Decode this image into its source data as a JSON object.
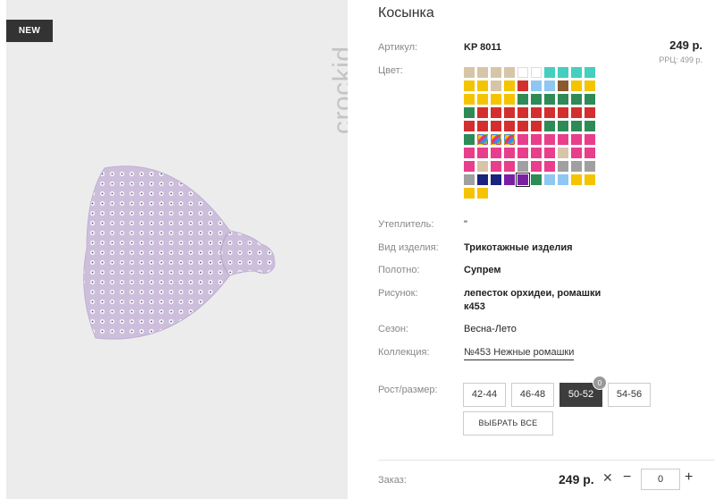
{
  "badge": "NEW",
  "brand": "crockid",
  "product": {
    "title": "Косынка",
    "price": "249 р.",
    "rrp": "РРЦ: 499 р."
  },
  "labels": {
    "article": "Артикул:",
    "color": "Цвет:",
    "insulation": "Утеплитель:",
    "type": "Вид изделия:",
    "fabric": "Полотно:",
    "pattern": "Рисунок:",
    "season": "Сезон:",
    "collection": "Коллекция:",
    "size": "Рост/размер:",
    "order": "Заказ:"
  },
  "values": {
    "article": "KP 8011",
    "insulation": "\"",
    "type": "Трикотажные изделия",
    "fabric": "Супрем",
    "pattern_line1": "лепесток орхидеи, ромашки",
    "pattern_line2": "к453",
    "season": "Весна-Лето",
    "collection": "№453 Нежные ромашки"
  },
  "swatch_colors": [
    "#d7c5a8",
    "#d7c5a8",
    "#d7c5a8",
    "#d7c5a8",
    "#ffffff",
    "#ffffff",
    "#45cfc0",
    "#45cfc0",
    "#45cfc0",
    "#45cfc0",
    "#f5c400",
    "#f5c400",
    "#d7c5a8",
    "#f5c400",
    "#d32f2f",
    "#8fc7f0",
    "#8fc7f0",
    "#8a5a2b",
    "#f5c400",
    "#f5c400",
    "#f5c400",
    "#f5c400",
    "#f5c400",
    "#f5c400",
    "#2e8b57",
    "#2e8b57",
    "#2e8b57",
    "#2e8b57",
    "#2e8b57",
    "#2e8b57",
    "#2e8b57",
    "#d32f2f",
    "#d32f2f",
    "#d32f2f",
    "#d32f2f",
    "#d32f2f",
    "#d32f2f",
    "#d32f2f",
    "#d32f2f",
    "#d32f2f",
    "#d32f2f",
    "#d32f2f",
    "#d32f2f",
    "#d32f2f",
    "#d32f2f",
    "#d32f2f",
    "#2e8b57",
    "#2e8b57",
    "#2e8b57",
    "#2e8b57",
    "#2e8b57",
    "#rainbow",
    "#rainbow",
    "#rainbow",
    "#e83e8c",
    "#e83e8c",
    "#e83e8c",
    "#e83e8c",
    "#e83e8c",
    "#e83e8c",
    "#e83e8c",
    "#e83e8c",
    "#e83e8c",
    "#e83e8c",
    "#e83e8c",
    "#e83e8c",
    "#e83e8c",
    "#d7c5a8",
    "#e83e8c",
    "#e83e8c",
    "#e83e8c",
    "#d7c5a8",
    "#e83e8c",
    "#e83e8c",
    "#a0a0a0",
    "#e83e8c",
    "#e83e8c",
    "#a0a0a0",
    "#a0a0a0",
    "#a0a0a0",
    "#a0a0a0",
    "#1a237e",
    "#1a237e",
    "#7b1fa2",
    "#7b1fa2",
    "#2e8b57",
    "#8fc7f0",
    "#8fc7f0",
    "#f5c400",
    "#f5c400",
    "#f5c400",
    "#f5c400"
  ],
  "selected_swatch_index": 84,
  "sizes": [
    {
      "label": "42-44",
      "active": false
    },
    {
      "label": "46-48",
      "active": false
    },
    {
      "label": "50-52",
      "active": true,
      "count": "0"
    },
    {
      "label": "54-56",
      "active": false
    }
  ],
  "select_all": "ВЫБРАТЬ ВСЕ",
  "order": {
    "price": "249 р.",
    "remove": "✕",
    "minus": "−",
    "qty": "0",
    "plus": "+"
  }
}
